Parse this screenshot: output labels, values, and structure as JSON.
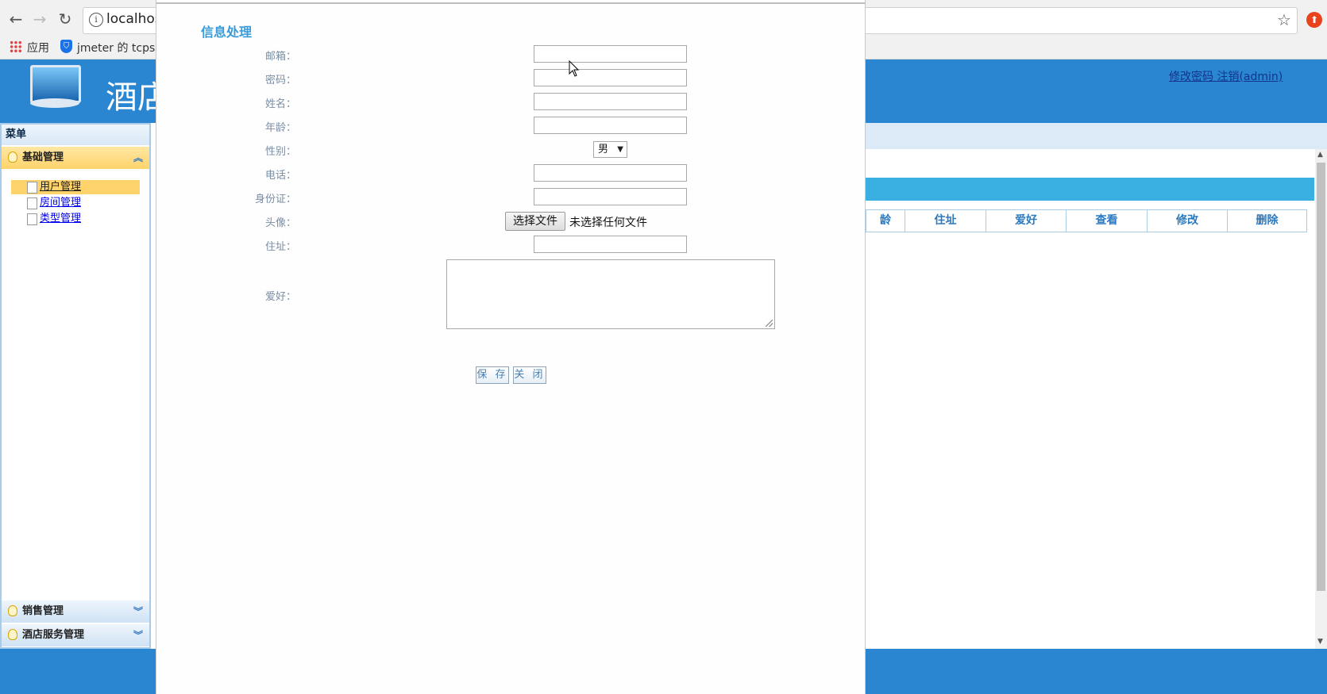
{
  "browser": {
    "url": "localhos",
    "bookmarks": {
      "apps_label": "应用",
      "item_label": "jmeter 的 tcpsa"
    },
    "icons": [
      "back-icon",
      "forward-icon",
      "reload-icon",
      "info-icon",
      "star-icon",
      "extension-icon",
      "apps-grid-icon",
      "bookmark-shield-icon"
    ]
  },
  "app": {
    "title": "酒店",
    "header_links": "修改密码 注销(admin)",
    "menu": {
      "header": "菜单",
      "groups": [
        {
          "label": "基础管理",
          "expanded": true,
          "items": [
            "用户管理",
            "房间管理",
            "类型管理"
          ]
        },
        {
          "label": "销售管理",
          "expanded": false
        },
        {
          "label": "酒店服务管理",
          "expanded": false
        }
      ]
    },
    "table": {
      "columns": [
        "龄",
        "住址",
        "爱好",
        "查看",
        "修改",
        "删除"
      ]
    }
  },
  "modal": {
    "title": "信息处理",
    "fields": {
      "email": "邮箱：",
      "password": "密码：",
      "name": "姓名：",
      "age": "年龄：",
      "gender": "性别：",
      "phone": "电话：",
      "id_card": "身份证：",
      "avatar": "头像：",
      "address": "住址：",
      "hobby": "爱好："
    },
    "gender_value": "男",
    "file_button": "选择文件",
    "file_status": "未选择任何文件",
    "save_label": "保 存",
    "close_label": "关 闭"
  },
  "colors": {
    "header_blue": "#2a86d1",
    "accent_title": "#3a9ad9",
    "menu_active": "#ffd36b"
  }
}
